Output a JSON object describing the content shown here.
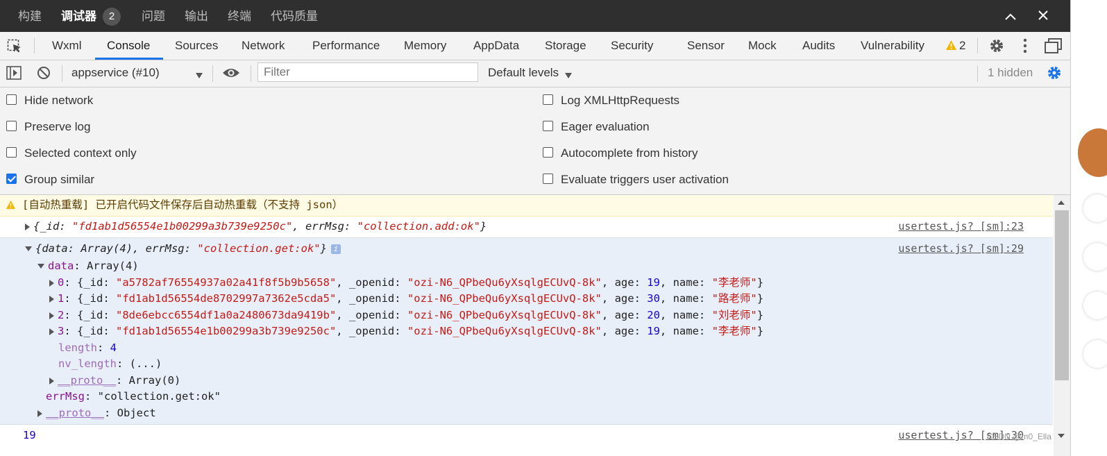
{
  "topbar": {
    "tabs": [
      "构建",
      "调试器",
      "问题",
      "输出",
      "终端",
      "代码质量"
    ],
    "active_tab": "调试器",
    "badge": "2",
    "collapse_icon": "chevron-up-icon",
    "close_icon": "close-icon"
  },
  "tabbar": {
    "tabs": [
      "Wxml",
      "Console",
      "Sources",
      "Network",
      "Performance",
      "Memory",
      "AppData",
      "Storage",
      "Security",
      "Sensor",
      "Mock",
      "Audits",
      "Vulnerability"
    ],
    "active_tab": "Console",
    "warning_count": "2",
    "accent": "#1a73e8"
  },
  "toolbar": {
    "context": "appservice (#10)",
    "filter_placeholder": "Filter",
    "levels": "Default levels",
    "hidden": "1 hidden"
  },
  "settings": {
    "left": [
      {
        "label": "Hide network",
        "checked": false
      },
      {
        "label": "Preserve log",
        "checked": false
      },
      {
        "label": "Selected context only",
        "checked": false
      },
      {
        "label": "Group similar",
        "checked": true
      }
    ],
    "right": [
      {
        "label": "Log XMLHttpRequests",
        "checked": false
      },
      {
        "label": "Eager evaluation",
        "checked": false
      },
      {
        "label": "Autocomplete from history",
        "checked": false
      },
      {
        "label": "Evaluate triggers user activation",
        "checked": false
      }
    ]
  },
  "console": {
    "warning": "[自动热重载] 已开启代码文件保存后自动热重载（不支持 json）",
    "msg1": {
      "id": "\"fd1ab1d56554e1b00299a3b739e9250c\"",
      "errMsg": "\"collection.add:ok\"",
      "source": "usertest.js? [sm]:23"
    },
    "msg2": {
      "summary_data": "Array(4)",
      "summary_errMsg": "\"collection.get:ok\"",
      "source": "usertest.js? [sm]:29",
      "data_label": "Array(4)",
      "items": [
        {
          "index": "0",
          "id": "\"a5782af76554937a02a41f8f5b9b5658\"",
          "openid": "\"ozi-N6_QPbeQu6yXsqlgECUvQ-8k\"",
          "age": "19",
          "name": "\"李老师\""
        },
        {
          "index": "1",
          "id": "\"fd1ab1d56554de8702997a7362e5cda5\"",
          "openid": "\"ozi-N6_QPbeQu6yXsqlgECUvQ-8k\"",
          "age": "30",
          "name": "\"路老师\""
        },
        {
          "index": "2",
          "id": "\"8de6ebcc6554df1a0a2480673da9419b\"",
          "openid": "\"ozi-N6_QPbeQu6yXsqlgECUvQ-8k\"",
          "age": "20",
          "name": "\"刘老师\""
        },
        {
          "index": "3",
          "id": "\"fd1ab1d56554e1b00299a3b739e9250c\"",
          "openid": "\"ozi-N6_QPbeQu6yXsqlgECUvQ-8k\"",
          "age": "19",
          "name": "\"李老师\""
        }
      ],
      "length": "4",
      "nv_length": "(...)",
      "proto_array": "Array(0)",
      "errMsg": "\"collection.get:ok\"",
      "proto_object": "Object"
    },
    "msg3": {
      "value": "19",
      "source": "usertest.js? [sm]:30"
    },
    "watermark": "CSDN @m0_Ella"
  }
}
